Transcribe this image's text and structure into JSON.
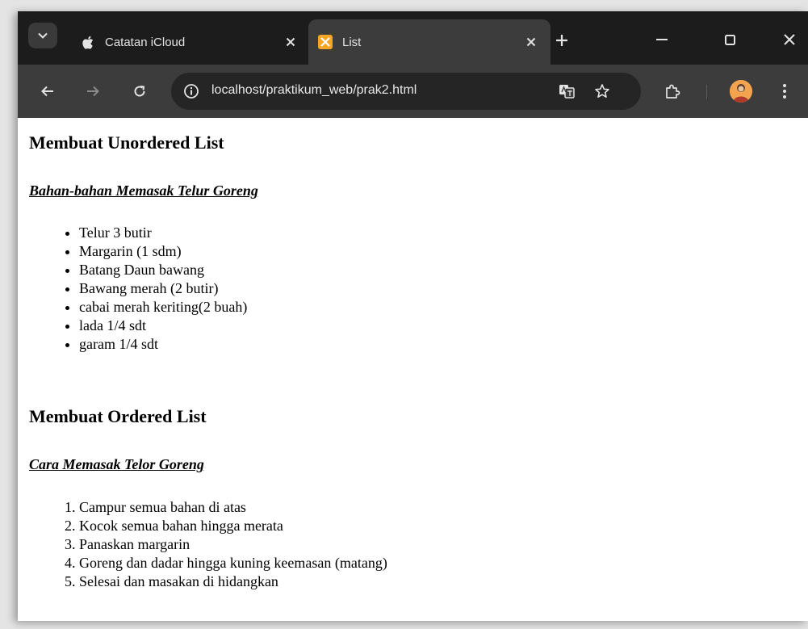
{
  "browser": {
    "tabs": [
      {
        "title": "Catatan iCloud",
        "active": false,
        "icon": "apple-icon"
      },
      {
        "title": "List",
        "active": true,
        "icon": "xampp-icon"
      }
    ],
    "address": {
      "url": "localhost/praktikum_web/prak2.html"
    },
    "colors": {
      "tabstrip": "#1c1c1c",
      "toolbar": "#3c3c3c",
      "omnibox": "#252525",
      "xampp": "#f5a623"
    }
  },
  "page": {
    "heading1": "Membuat Unordered List",
    "subheading1": "Bahan-bahan Memasak Telur Goreng",
    "ingredients": [
      "Telur 3 butir",
      "Margarin (1 sdm)",
      "Batang Daun bawang",
      "Bawang merah (2 butir)",
      "cabai merah keriting(2 buah)",
      "lada 1/4 sdt",
      "garam 1/4 sdt"
    ],
    "heading2": "Membuat Ordered List",
    "subheading2": "Cara Memasak Telor Goreng",
    "steps": [
      "Campur semua bahan di atas",
      "Kocok semua bahan hingga merata",
      "Panaskan margarin",
      "Goreng dan dadar hingga kuning keemasan (matang)",
      "Selesai dan masakan di hidangkan"
    ]
  }
}
